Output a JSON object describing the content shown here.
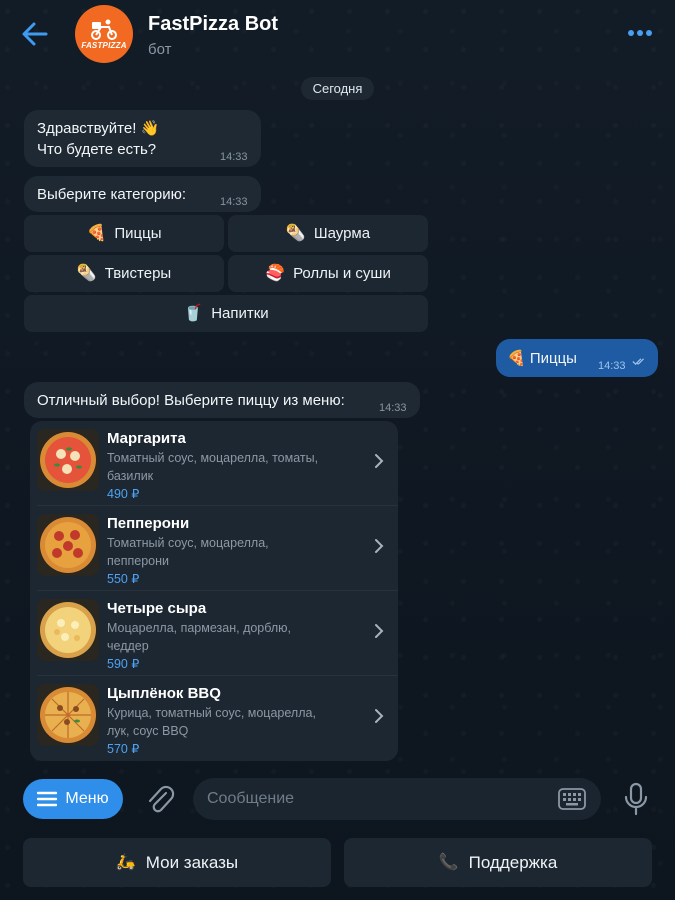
{
  "header": {
    "title": "FastPizza Bot",
    "subtitle": "бот",
    "avatar_brand": "FASTPIZZA"
  },
  "date_separator": "Сегодня",
  "messages": [
    {
      "line1": "Здравствуйте! 👋",
      "line2": "Что будете есть?",
      "time": "14:33"
    },
    {
      "text": "Выберите категорию:",
      "time": "14:33"
    },
    {
      "text": "🍕 Пиццы",
      "time": "14:33"
    },
    {
      "text": "Отличный выбор! Выберите пиццу из меню:",
      "time": "14:33"
    }
  ],
  "category_buttons": [
    {
      "emoji": "🍕",
      "label": "Пиццы"
    },
    {
      "emoji": "🌯",
      "label": "Шаурма"
    },
    {
      "emoji": "🌯",
      "label": "Твистеры"
    },
    {
      "emoji": "🍣",
      "label": "Роллы и суши"
    },
    {
      "emoji": "🥤",
      "label": "Напитки"
    }
  ],
  "menu_items": [
    {
      "name": "Маргарита",
      "desc1": "Томатный соус, моцарелла, томаты,",
      "desc2": "базилик",
      "price": "490 ₽",
      "topping": "basil"
    },
    {
      "name": "Пепперони",
      "desc1": "Томатный соус, моцарелла,",
      "desc2": "пепперони",
      "price": "550 ₽",
      "topping": "pepperoni"
    },
    {
      "name": "Четыре сыра",
      "desc1": "Моцарелла, пармезан, дорблю,",
      "desc2": "чеддер",
      "price": "590 ₽",
      "topping": "cheese"
    },
    {
      "name": "Цыплёнок BBQ",
      "desc1": "Курица, томатный соус, моцарелла,",
      "desc2": "лук, соус BBQ",
      "price": "570 ₽",
      "topping": "bbq"
    }
  ],
  "composer": {
    "menu_label": "Меню",
    "placeholder": "Сообщение"
  },
  "bottom_buttons": [
    {
      "emoji": "🛵",
      "label": "Мои заказы"
    },
    {
      "emoji": "📞",
      "label": "Поддержка"
    }
  ],
  "colors": {
    "accent": "#2e8ee9",
    "outgoing_bubble": "#1f5ba2",
    "avatar": "#f26a21",
    "price": "#4ea2f2"
  }
}
